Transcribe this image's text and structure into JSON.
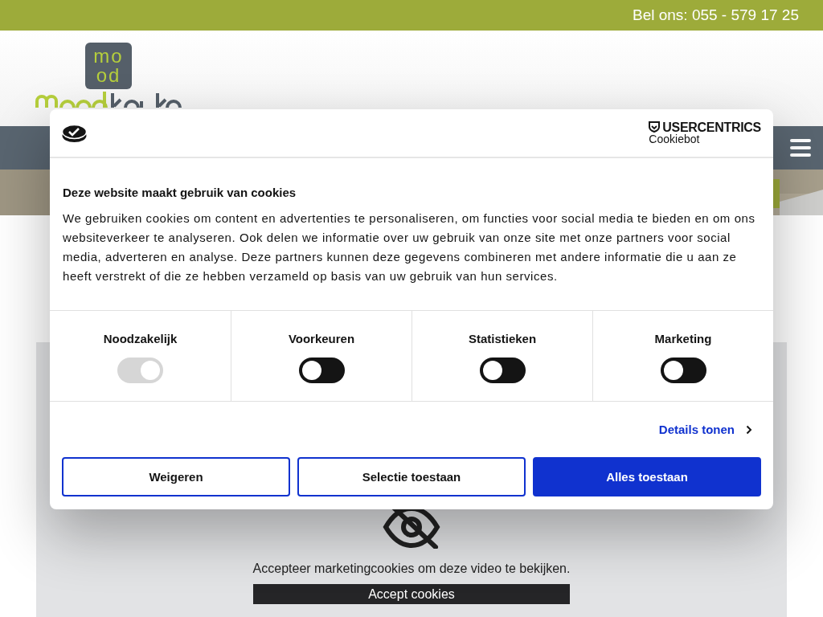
{
  "top_bar": {
    "phone": "Bel ons: 055 - 579 17 25"
  },
  "header": {
    "logo_mark": [
      "mo",
      "od"
    ]
  },
  "video_placeholder": {
    "message": "Accepteer marketingcookies om deze video te bekijken.",
    "button": "Accept cookies"
  },
  "cookie_dialog": {
    "brand": "USERCENTRICS",
    "brand_sub": "Cookiebot",
    "title": "Deze website maakt gebruik van cookies",
    "body": "We gebruiken cookies om content en advertenties te personaliseren, om functies voor social media te bieden en om ons websiteverkeer te analyseren. Ook delen we informatie over uw gebruik van onze site met onze partners voor social media, adverteren en analyse. Deze partners kunnen deze gegevens combineren met andere informatie die u aan ze heeft verstrekt of die ze hebben verzameld op basis van uw gebruik van hun services.",
    "categories": [
      {
        "label": "Noodzakelijk",
        "checked": true,
        "disabled": true
      },
      {
        "label": "Voorkeuren",
        "checked": false,
        "disabled": false
      },
      {
        "label": "Statistieken",
        "checked": false,
        "disabled": false
      },
      {
        "label": "Marketing",
        "checked": false,
        "disabled": false
      }
    ],
    "details_link": "Details tonen",
    "buttons": [
      {
        "label": "Weigeren",
        "kind": "outline"
      },
      {
        "label": "Selectie toestaan",
        "kind": "outline"
      },
      {
        "label": "Alles toestaan",
        "kind": "primary"
      }
    ]
  }
}
